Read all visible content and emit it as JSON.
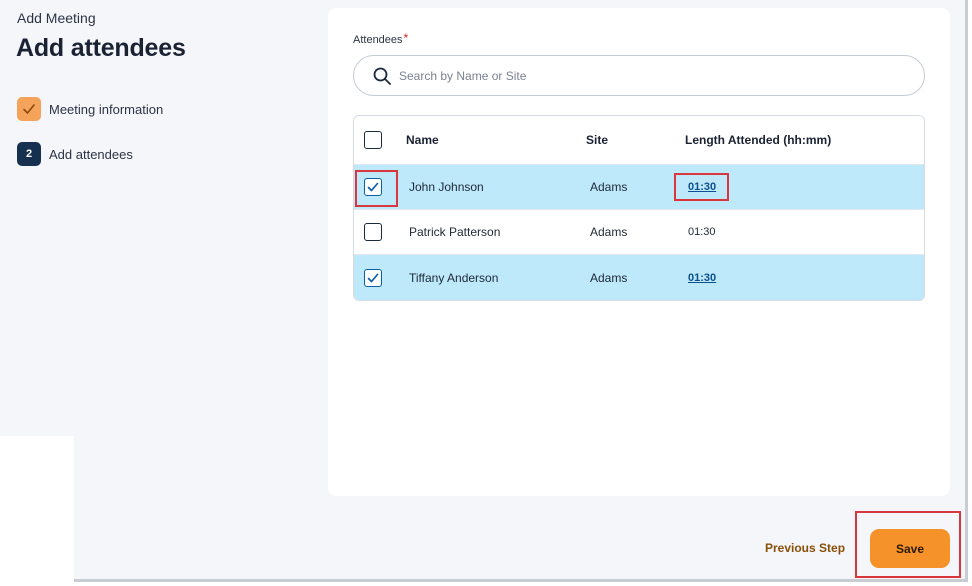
{
  "header": {
    "breadcrumb": "Add Meeting",
    "title": "Add attendees"
  },
  "steps": [
    {
      "label": "Meeting information",
      "status": "done",
      "icon": "check-icon"
    },
    {
      "label": "Add attendees",
      "status": "current",
      "number": "2"
    }
  ],
  "attendees": {
    "label": "Attendees",
    "required_mark": "*",
    "search": {
      "placeholder": "Search by Name or Site",
      "value": ""
    }
  },
  "table": {
    "columns": [
      "Name",
      "Site",
      "Length Attended (hh:mm)"
    ],
    "rows": [
      {
        "name": "John Johnson",
        "site": "Adams",
        "length": "01:30",
        "checked": true
      },
      {
        "name": "Patrick Patterson",
        "site": "Adams",
        "length": "01:30",
        "checked": false
      },
      {
        "name": "Tiffany Anderson",
        "site": "Adams",
        "length": "01:30",
        "checked": true
      }
    ]
  },
  "footer": {
    "previous_label": "Previous Step",
    "save_label": "Save"
  },
  "colors": {
    "selected_row": "#bde9fb",
    "save_button": "#f5922a",
    "step_done": "#f5a35a",
    "step_current": "#16304f",
    "highlight": "#d9373d"
  }
}
